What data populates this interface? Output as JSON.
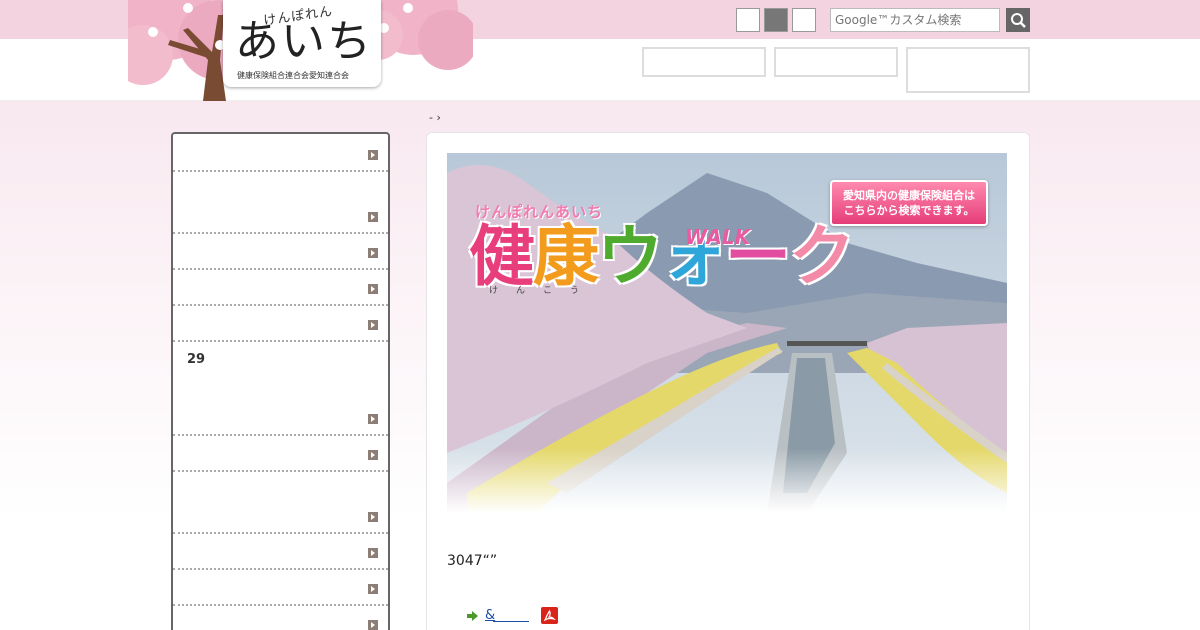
{
  "header": {
    "logo": {
      "kana": "けんぽれん",
      "main": "あいち",
      "subtitle": "健康保険組合連合会愛知連合会"
    },
    "search": {
      "placeholder": "Google™カスタム検索"
    },
    "font_size_buttons": [
      "",
      "",
      ""
    ]
  },
  "breadcrumb": "- ›",
  "sidebar": {
    "items": [
      {
        "label": ""
      },
      {
        "label": ""
      },
      {
        "label": ""
      },
      {
        "label": ""
      },
      {
        "label": ""
      },
      {
        "label": "29"
      },
      {
        "label": ""
      },
      {
        "label": ""
      },
      {
        "label": ""
      },
      {
        "label": ""
      },
      {
        "label": ""
      }
    ]
  },
  "banner": {
    "kana": "けんぽれんあいち",
    "title_chars": [
      "健",
      "康",
      "ウ",
      "ォ",
      "ー",
      "ク"
    ],
    "walk": "WALK",
    "furigana": "けんこう",
    "search_button_line1": "愛知県内の健康保険組合は",
    "search_button_line2": "こちらから検索できます。"
  },
  "main": {
    "body_text": "3047“”",
    "doc_link": "&"
  },
  "colors": {
    "header_pink": "#f2d3df",
    "accent_pink": "#e53d78",
    "link_blue": "#1a4ea3",
    "pdf_red": "#d9241c"
  }
}
